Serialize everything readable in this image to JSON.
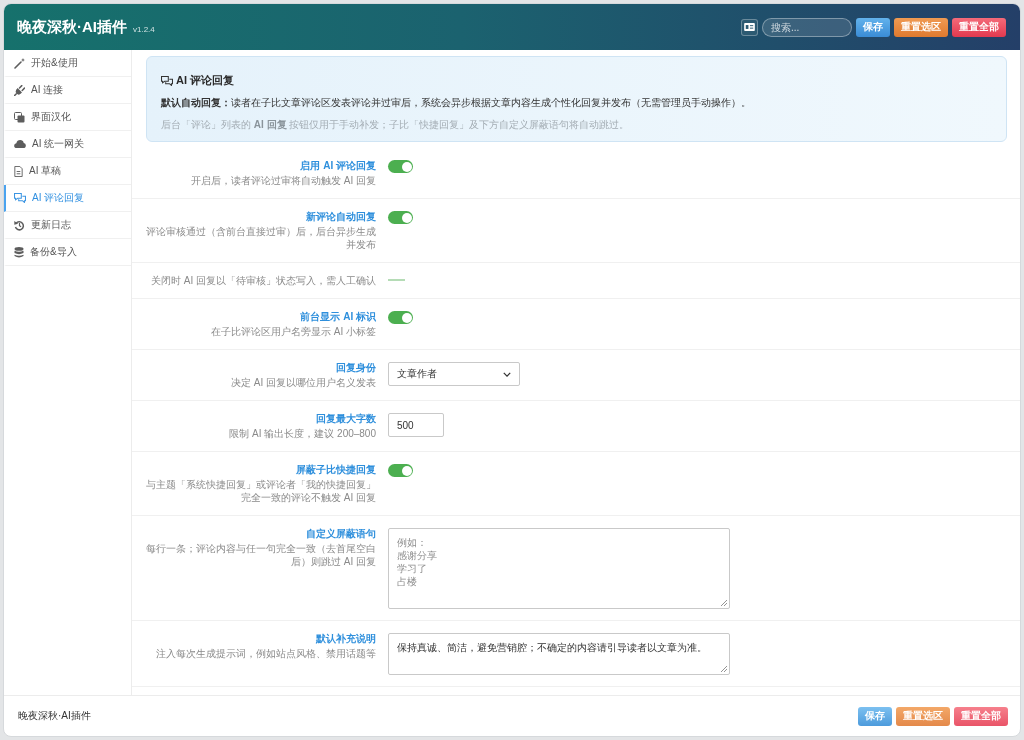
{
  "header": {
    "title": "晚夜深秋·AI插件",
    "version": "v1.2.4",
    "search": {
      "placeholder": "搜索..."
    },
    "buttons": [
      {
        "label": "保存",
        "kind": "save"
      },
      {
        "label": "重置选区",
        "kind": "reset_section"
      },
      {
        "label": "重置全部",
        "kind": "reset_all"
      }
    ]
  },
  "sidebar": {
    "items": [
      {
        "label": "开始&使用",
        "selected": false
      },
      {
        "label": "AI 连接",
        "selected": false
      },
      {
        "label": "界面汉化",
        "selected": false
      },
      {
        "label": "AI 统一网关",
        "selected": false
      },
      {
        "label": "AI 草稿",
        "selected": false
      },
      {
        "label": "AI 评论回复",
        "selected": true
      },
      {
        "label": "更新日志",
        "selected": false
      },
      {
        "label": "备份&导入",
        "selected": false
      }
    ]
  },
  "intro": {
    "title": "AI 评论回复",
    "lead": "**默认自动回复：**读者在子比文章评论区发表评论并过审后，系统会异步根据文章内容生成个性化回复并发布（无需管理员手动操作）。",
    "note": "后台「评论」列表的 **AI 回复** 按钮仅用于手动补发；子比「快捷回复」及下方自定义屏蔽语句将自动跳过。"
  },
  "settings": [
    {
      "kind": "toggle",
      "label": "启用 AI 评论回复",
      "description": "开启后，读者评论过审将自动触发 AI 回复",
      "on": true
    },
    {
      "kind": "toggle",
      "label": "新评论自动回复",
      "description": "评论审核通过（含前台直接过审）后，后台异步生成并发布",
      "on": true
    },
    {
      "kind": "note",
      "description": "关闭时 AI 回复以「待审核」状态写入，需人工确认"
    },
    {
      "kind": "toggle",
      "label": "前台显示 AI 标识",
      "description": "在子比评论区用户名旁显示 AI 小标签",
      "on": true
    },
    {
      "kind": "select",
      "label": "回复身份",
      "description": "决定 AI 回复以哪位用户名义发表",
      "value": "文章作者"
    },
    {
      "kind": "number",
      "label": "回复最大字数",
      "description": "限制 AI 输出长度，建议 200–800",
      "value": "500"
    },
    {
      "kind": "toggle",
      "label": "屏蔽子比快捷回复",
      "description": "与主题「系统快捷回复」或评论者「我的快捷回复」完全一致的评论不触发 AI 回复",
      "on": true
    },
    {
      "kind": "textarea",
      "label": "自定义屏蔽语句",
      "description": "每行一条；评论内容与任一句完全一致（去首尾空白后）则跳过 AI 回复",
      "placeholder": [
        "例如：",
        "感谢分享",
        "学习了",
        "占楼"
      ]
    },
    {
      "kind": "textarea",
      "label": "默认补充说明",
      "description": "注入每次生成提示词，例如站点风格、禁用话题等",
      "value": "保持真诚、简洁，避免营销腔；不确定的内容请引导读者以文章为准。"
    }
  ],
  "footer": {
    "text": "晚夜深秋·AI插件",
    "buttons": [
      {
        "label": "保存",
        "kind": "save"
      },
      {
        "label": "重置选区",
        "kind": "reset_section"
      },
      {
        "label": "重置全部",
        "kind": "reset_all"
      }
    ]
  }
}
